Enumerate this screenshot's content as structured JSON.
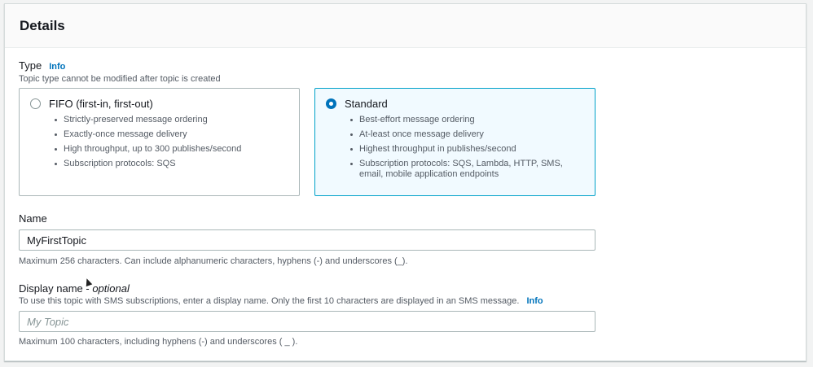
{
  "header": {
    "title": "Details"
  },
  "type_field": {
    "label": "Type",
    "info": "Info",
    "description": "Topic type cannot be modified after topic is created",
    "options": [
      {
        "title": "FIFO (first-in, first-out)",
        "selected": false,
        "bullets": [
          "Strictly-preserved message ordering",
          "Exactly-once message delivery",
          "High throughput, up to 300 publishes/second",
          "Subscription protocols: SQS"
        ]
      },
      {
        "title": "Standard",
        "selected": true,
        "bullets": [
          "Best-effort message ordering",
          "At-least once message delivery",
          "Highest throughput in publishes/second",
          "Subscription protocols: SQS, Lambda, HTTP, SMS, email, mobile application endpoints"
        ]
      }
    ]
  },
  "name_field": {
    "label": "Name",
    "value": "MyFirstTopic",
    "constraint": "Maximum 256 characters. Can include alphanumeric characters, hyphens (-) and underscores (_)."
  },
  "display_name_field": {
    "label": "Display name",
    "optional": "optional",
    "description": "To use this topic with SMS subscriptions, enter a display name. Only the first 10 characters are displayed in an SMS message.",
    "info": "Info",
    "placeholder": "My Topic",
    "value": "",
    "constraint": "Maximum 100 characters, including hyphens (-) and underscores ( _ )."
  },
  "colors": {
    "accent": "#0073bb",
    "selected_tile_bg": "#f1faff",
    "selected_tile_border": "#00a1c9"
  }
}
